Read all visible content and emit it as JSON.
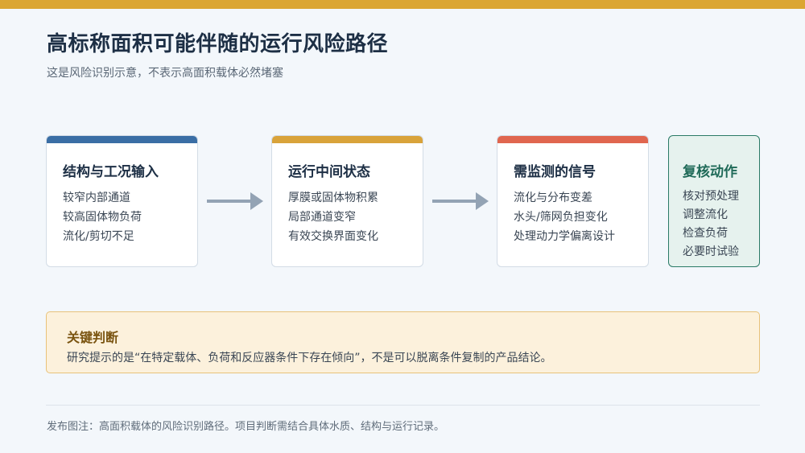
{
  "header": {
    "title": "高标称面积可能伴随的运行风险路径",
    "subtitle": "这是风险识别示意，不表示高面积载体必然堵塞"
  },
  "colors": {
    "accent_bar": "#dba633",
    "band_blue": "#3a6ea5",
    "band_gold": "#d9a33a",
    "band_red": "#e0664f",
    "review_green": "#2a7a66",
    "arrow_gray": "#93a3b4"
  },
  "flow": {
    "cards": [
      {
        "title": "结构与工况输入",
        "items": [
          "较窄内部通道",
          "较高固体物负荷",
          "流化/剪切不足"
        ]
      },
      {
        "title": "运行中间状态",
        "items": [
          "厚膜或固体物积累",
          "局部通道变窄",
          "有效交换界面变化"
        ]
      },
      {
        "title": "需监测的信号",
        "items": [
          "流化与分布变差",
          "水头/筛网负担变化",
          "处理动力学偏离设计"
        ]
      },
      {
        "title": "复核动作",
        "items": [
          "核对预处理",
          "调整流化",
          "检查负荷",
          "必要时试验"
        ]
      }
    ]
  },
  "note": {
    "title": "关键判断",
    "text": "研究提示的是“在特定载体、负荷和反应器条件下存在倾向”，不是可以脱离条件复制的产品结论。"
  },
  "footer": {
    "caption": "发布图注：高面积载体的风险识别路径。项目判断需结合具体水质、结构与运行记录。"
  }
}
